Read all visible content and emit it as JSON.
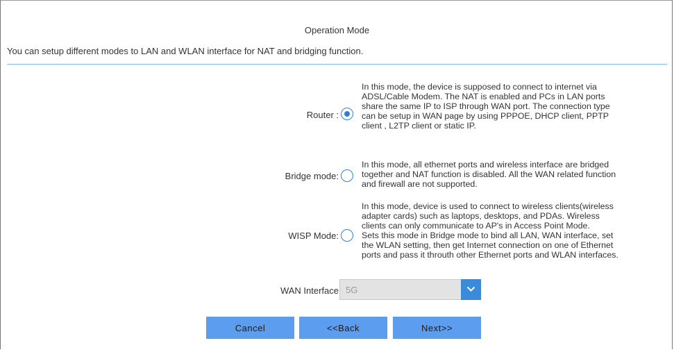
{
  "header": {
    "title": "Operation Mode",
    "subtitle": "You can setup different modes to LAN and WLAN interface for NAT and bridging function."
  },
  "modes": [
    {
      "label": "Router :",
      "selected": true,
      "description": [
        "In this mode, the device is supposed to connect to internet via",
        "ADSL/Cable Modem. The NAT is enabled and PCs in LAN ports",
        "share the same IP to ISP through WAN port. The connection type",
        "can be setup in WAN page by using PPPOE, DHCP client, PPTP",
        "client , L2TP client or static IP."
      ]
    },
    {
      "label": "Bridge mode:",
      "selected": false,
      "description": [
        "In this mode, all ethernet ports and wireless interface are bridged",
        "together and NAT function is disabled. All the WAN related function",
        "and firewall are not supported."
      ]
    },
    {
      "label": "WISP Mode:",
      "selected": false,
      "description": [
        "In this mode, device is used to connect to wireless clients(wireless",
        "adapter cards) such as laptops, desktops, and PDAs. Wireless",
        "clients can only communicate to AP's in Access Point Mode.",
        "Sets this mode in Bridge mode to bind all LAN, WAN interface, set",
        "the WLAN setting, then get Internet connection on one of Ethernet",
        "ports and pass it throuth other Ethernet ports and WLAN interfaces."
      ]
    }
  ],
  "wan_interface": {
    "label": "WAN Interface",
    "value": "5G"
  },
  "buttons": {
    "cancel": "Cancel",
    "back": "<<Back",
    "next": "Next>>"
  },
  "colors": {
    "accent": "#2f80d1",
    "button": "#5c9df0",
    "divider": "#7fb6e8"
  }
}
